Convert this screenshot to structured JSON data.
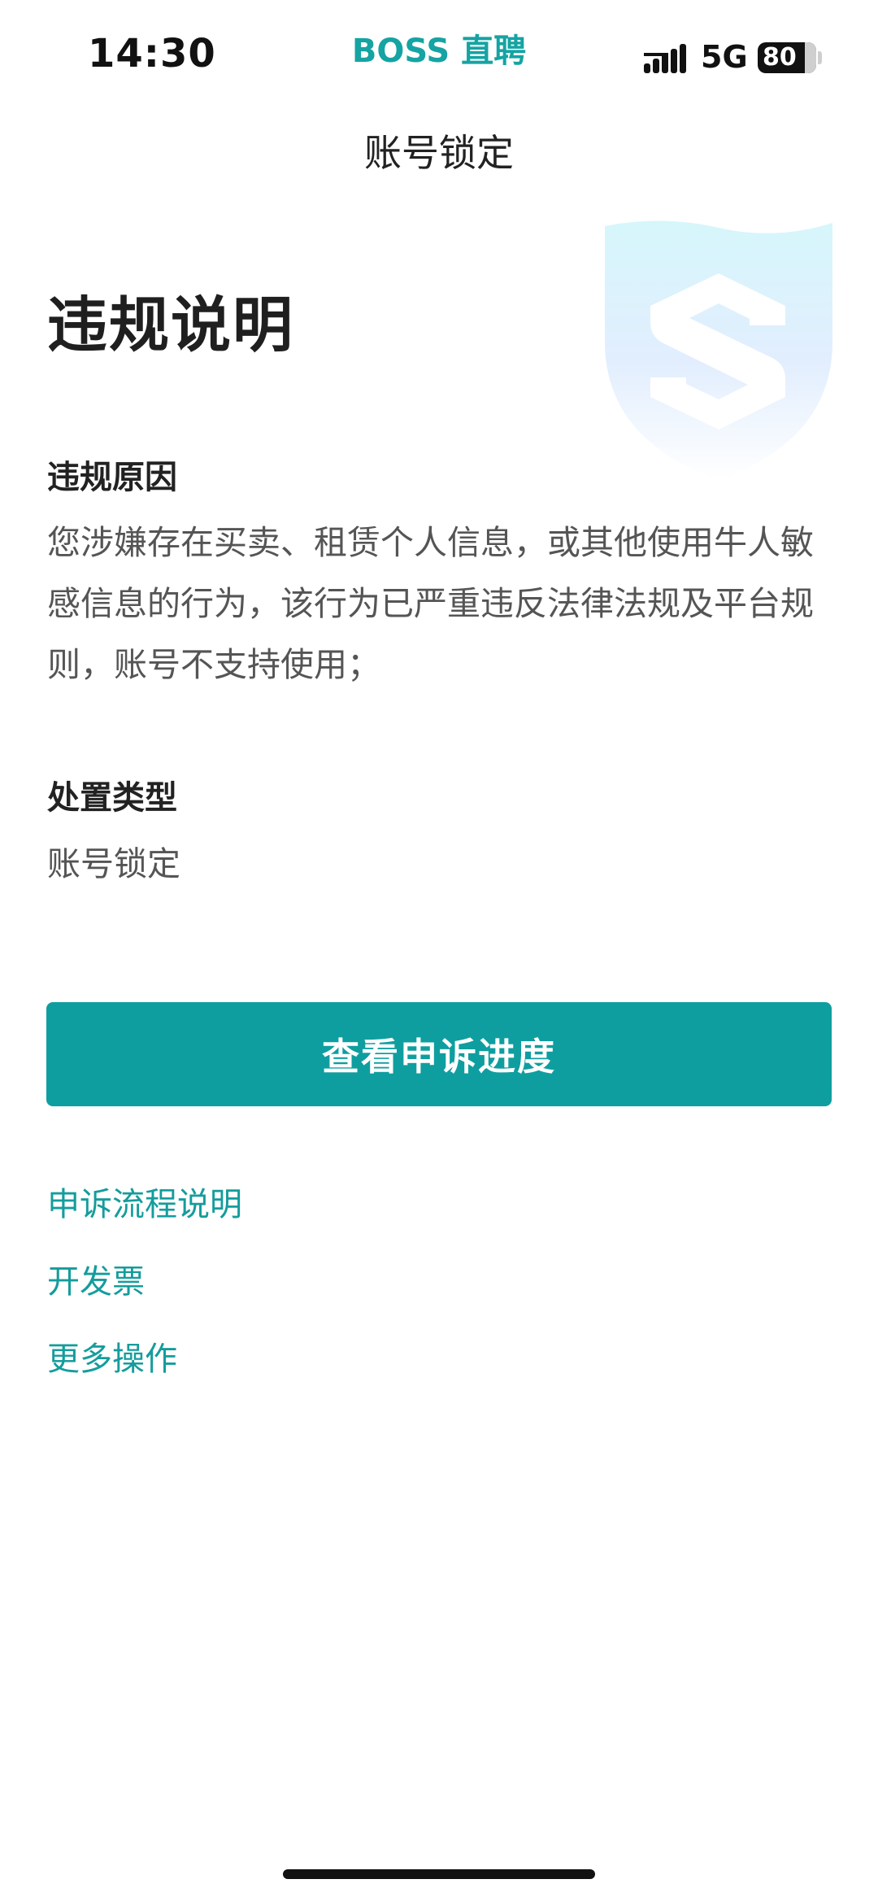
{
  "status_bar": {
    "time": "14:30",
    "app_name": "BOSS 直聘",
    "network": "5G",
    "battery": "80"
  },
  "nav": {
    "title": "账号锁定"
  },
  "content": {
    "heading": "违规说明",
    "reason_label": "违规原因",
    "reason_text": "您涉嫌存在买卖、租赁个人信息，或其他使用牛人敏感信息的行为，该行为已严重违反法律法规及平台规则，账号不支持使用；",
    "type_label": "处置类型",
    "type_value": "账号锁定"
  },
  "actions": {
    "primary_button": "查看申诉进度",
    "links": [
      "申诉流程说明",
      "开发票",
      "更多操作"
    ]
  },
  "icons": {
    "shield": "shield-s-icon",
    "signal": "signal-icon",
    "battery": "battery-icon"
  },
  "colors": {
    "accent": "#0f9ea0",
    "link": "#159c9c",
    "brand": "#15a3a3"
  }
}
